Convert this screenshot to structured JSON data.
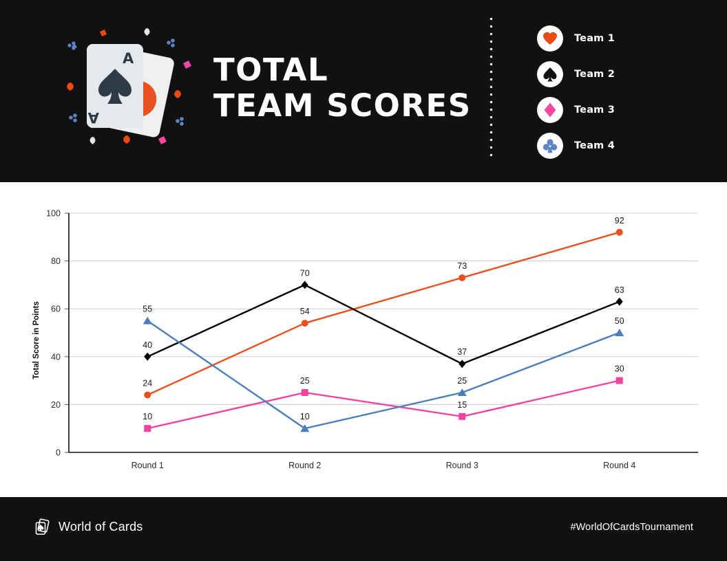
{
  "header": {
    "title_line1": "TOTAL",
    "title_line2": "TEAM SCORES",
    "card_illustration_name": "ace-of-spades-and-ace-of-diamonds",
    "legend": [
      {
        "label": "Team 1",
        "icon": "heart-icon",
        "color": "#ED4A12"
      },
      {
        "label": "Team 2",
        "icon": "spade-icon",
        "color": "#111111"
      },
      {
        "label": "Team 3",
        "icon": "diamond-icon",
        "color": "#F5479F"
      },
      {
        "label": "Team 4",
        "icon": "club-icon",
        "color": "#5B85C4"
      }
    ]
  },
  "chart_data": {
    "type": "line",
    "title": "TOTAL TEAM SCORES",
    "xlabel": "",
    "ylabel": "Total Score in Points",
    "categories": [
      "Round 1",
      "Round 2",
      "Round 3",
      "Round 4"
    ],
    "ylim": [
      0,
      100
    ],
    "yticks": [
      0,
      20,
      40,
      60,
      80,
      100
    ],
    "grid": true,
    "legend_position": "top-right",
    "series": [
      {
        "name": "Team 1",
        "color": "#E8501E",
        "marker": "circle",
        "values": [
          24,
          54,
          73,
          92
        ]
      },
      {
        "name": "Team 2",
        "color": "#000000",
        "marker": "diamond",
        "values": [
          40,
          70,
          37,
          63
        ]
      },
      {
        "name": "Team 3",
        "color": "#F0439E",
        "marker": "square",
        "values": [
          10,
          25,
          15,
          30
        ]
      },
      {
        "name": "Team 4",
        "color": "#4A7EBB",
        "marker": "triangle",
        "values": [
          55,
          10,
          25,
          50
        ]
      }
    ]
  },
  "footer": {
    "brand_name": "World of Cards",
    "brand_icon": "playing-cards-icon",
    "hashtag": "#WorldOfCardsTournament"
  }
}
